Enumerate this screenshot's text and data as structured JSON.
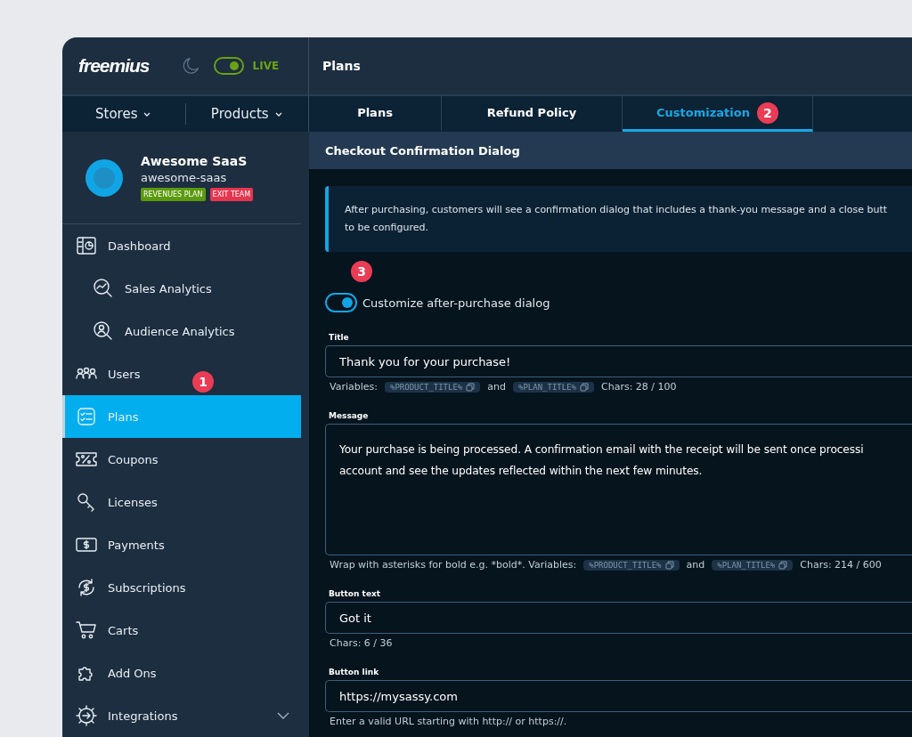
{
  "header": {
    "logo": "freemius",
    "live_toggle": {
      "on": true,
      "label": "LIVE"
    },
    "title": "Plans"
  },
  "nav": [
    {
      "label": "Stores"
    },
    {
      "label": "Products"
    }
  ],
  "tabs": [
    {
      "label": "Plans",
      "selected": false
    },
    {
      "label": "Refund Policy",
      "selected": false
    },
    {
      "label": "Customization",
      "selected": true,
      "callout": "2"
    }
  ],
  "store": {
    "name": "Awesome SaaS",
    "slug": "awesome-saas",
    "tags": [
      {
        "label": "REVENUES PLAN",
        "color": "#5b9a0f"
      },
      {
        "label": "EXIT TEAM",
        "color": "#e8354f"
      }
    ]
  },
  "sidebar": {
    "items": [
      {
        "label": "Dashboard",
        "selected": false,
        "children": [
          {
            "label": "Sales Analytics",
            "selected": false
          },
          {
            "label": "Audience Analytics",
            "selected": false
          }
        ]
      },
      {
        "label": "Users",
        "selected": false,
        "callout": "1"
      },
      {
        "label": "Plans",
        "selected": true
      },
      {
        "label": "Coupons",
        "selected": false
      },
      {
        "label": "Licenses",
        "selected": false
      },
      {
        "label": "Payments",
        "selected": false
      },
      {
        "label": "Subscriptions",
        "selected": false
      },
      {
        "label": "Carts",
        "selected": false
      },
      {
        "label": "Add Ons",
        "selected": false
      },
      {
        "label": "Integrations",
        "selected": false,
        "expanded": false
      }
    ]
  },
  "section": {
    "title": "Checkout Confirmation Dialog",
    "info_lines": [
      "After purchasing, customers will see a confirmation dialog that includes a thank-you message and a close butt",
      "to be configured."
    ],
    "toggle": {
      "label": "Customize after-purchase dialog",
      "on": true,
      "callout": "3"
    },
    "fields": [
      {
        "kind": "input",
        "label": "Title",
        "value": "Thank you for your purchase!",
        "hint": [
          {
            "kind": "text",
            "text": "Variables:"
          },
          {
            "kind": "chip",
            "text": "%PRODUCT_TITLE%"
          },
          {
            "kind": "text",
            "text": "and"
          },
          {
            "kind": "chip",
            "text": "%PLAN_TITLE%"
          },
          {
            "kind": "text",
            "text": "Chars: 28 / 100"
          }
        ]
      },
      {
        "kind": "textarea",
        "label": "Message",
        "lines": [
          "Your purchase is being processed. A confirmation email with the receipt will be sent once processi",
          "account and see the updates reflected within the next few minutes."
        ],
        "hint": [
          {
            "kind": "text",
            "text": "Wrap with asterisks for bold e.g. *bold*. Variables:"
          },
          {
            "kind": "chip",
            "text": "%PRODUCT_TITLE%"
          },
          {
            "kind": "text",
            "text": "and"
          },
          {
            "kind": "chip",
            "text": "%PLAN_TITLE%"
          },
          {
            "kind": "text",
            "text": "Chars: 214 / 600"
          }
        ]
      },
      {
        "kind": "input",
        "label": "Button text",
        "value": "Got it",
        "hint": [
          {
            "kind": "text",
            "text": "Chars: 6 / 36"
          }
        ]
      },
      {
        "kind": "input",
        "label": "Button link",
        "value": "https://mysassy.com",
        "hint": [
          {
            "kind": "text",
            "text": "Enter a valid URL starting with http:// or https://."
          }
        ]
      }
    ]
  }
}
